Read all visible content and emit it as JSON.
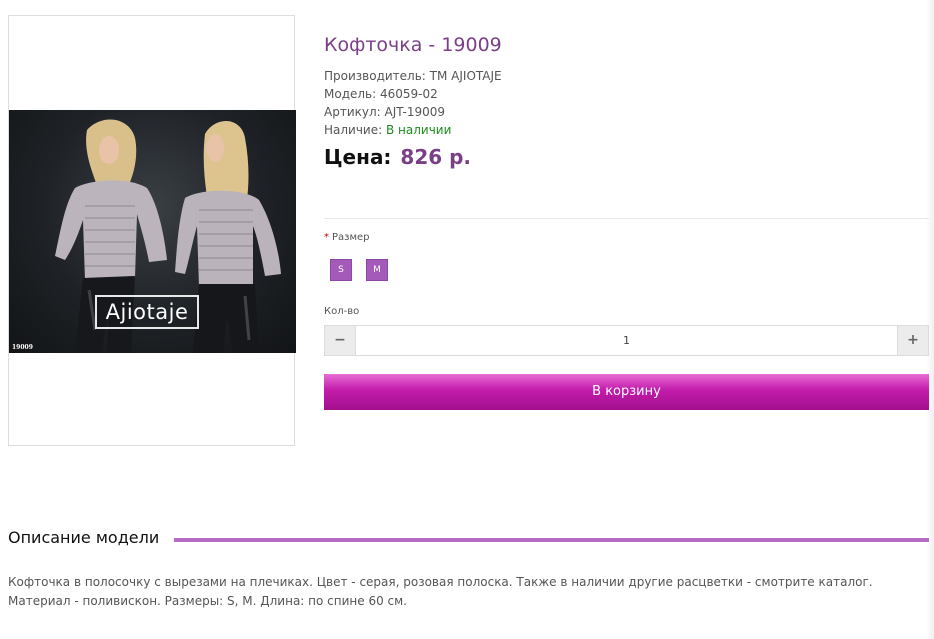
{
  "product": {
    "title": "Кофточка - 19009",
    "manufacturer_label": "Производитель:",
    "manufacturer_value": "ТМ AJIOTAJE",
    "model_label": "Модель:",
    "model_value": "46059-02",
    "sku_label": "Артикул:",
    "sku_value": "AJT-19009",
    "availability_label": "Наличие:",
    "availability_value": "В наличии",
    "price_label": "Цена:",
    "price_value": "826 р."
  },
  "image": {
    "brand_text": "Ajiotaje",
    "code_text": "19009"
  },
  "options": {
    "required_mark": "*",
    "size_label": "Размер",
    "sizes": [
      "S",
      "M"
    ]
  },
  "quantity": {
    "label": "Кол-во",
    "value": "1",
    "minus_icon": "minus-icon",
    "plus_icon": "plus-icon"
  },
  "cart": {
    "button_label": "В корзину"
  },
  "description": {
    "heading": "Описание модели",
    "text": "Кофточка в полосочку с вырезами на плечиках. Цвет - серая, розовая полоска. Также в наличии другие расцветки - смотрите каталог. Материал - поливискон. Размеры: S, M. Длина: по спине 60 см."
  },
  "colors": {
    "accent": "#7a3f86",
    "size_button": "#a35ab8",
    "cart_button": "#c21cab",
    "in_stock": "#1e8c1e",
    "description_rule": "#b46cc5"
  }
}
